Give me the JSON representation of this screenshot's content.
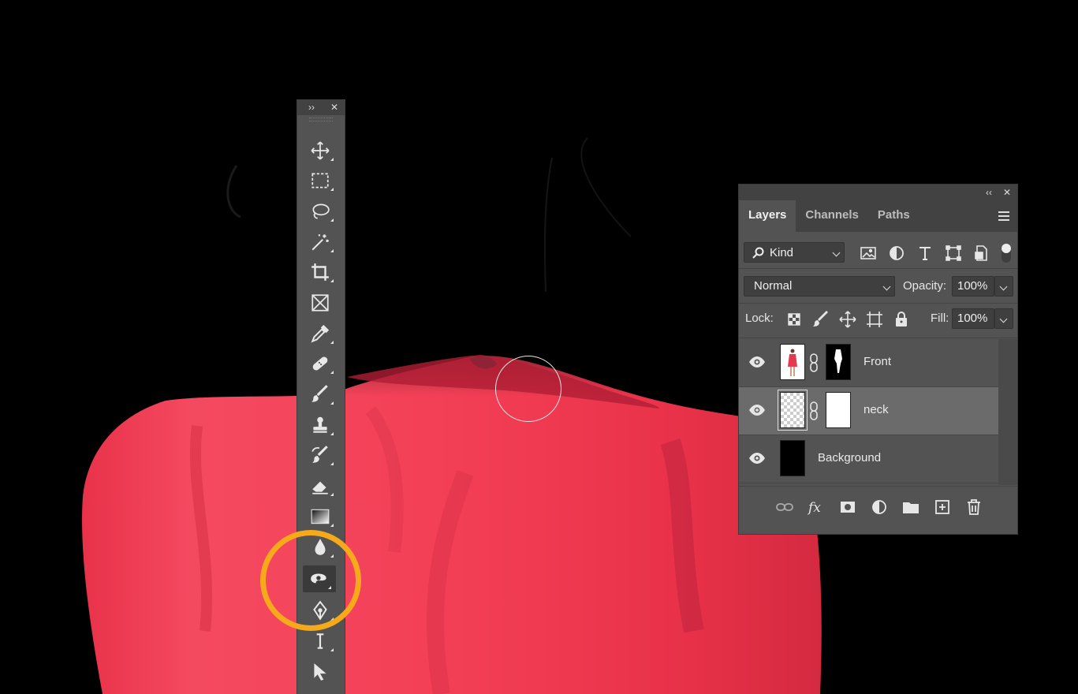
{
  "app": {
    "tools_panel": {
      "expand_glyph": "››",
      "close_glyph": "✕",
      "tools": [
        {
          "name": "move-tool",
          "icon": "move-icon"
        },
        {
          "name": "marquee-tool",
          "icon": "rect-marquee-icon"
        },
        {
          "name": "lasso-tool",
          "icon": "lasso-icon"
        },
        {
          "name": "magic-wand-tool",
          "icon": "magic-wand-icon"
        },
        {
          "name": "crop-tool",
          "icon": "crop-icon"
        },
        {
          "name": "frame-tool",
          "icon": "frame-icon"
        },
        {
          "name": "eyedropper-tool",
          "icon": "eyedropper-icon"
        },
        {
          "name": "healing-brush-tool",
          "icon": "bandage-icon"
        },
        {
          "name": "brush-tool",
          "icon": "brush-icon"
        },
        {
          "name": "clone-stamp-tool",
          "icon": "stamp-icon"
        },
        {
          "name": "history-brush-tool",
          "icon": "history-brush-icon"
        },
        {
          "name": "eraser-tool",
          "icon": "eraser-icon"
        },
        {
          "name": "gradient-tool",
          "icon": "gradient-icon"
        },
        {
          "name": "blur-tool",
          "icon": "blur-drop-icon"
        },
        {
          "name": "dodge-burn-tool",
          "icon": "burn-hand-icon",
          "active": true
        },
        {
          "name": "pen-tool",
          "icon": "pen-icon"
        },
        {
          "name": "type-tool",
          "icon": "type-icon"
        },
        {
          "name": "path-selection-tool",
          "icon": "arrow-icon"
        }
      ]
    },
    "layers_panel": {
      "collapse_glyph": "‹‹",
      "close_glyph": "✕",
      "tabs": [
        {
          "label": "Layers",
          "active": true
        },
        {
          "label": "Channels",
          "active": false
        },
        {
          "label": "Paths",
          "active": false
        }
      ],
      "filter_kind": "Kind",
      "blend_mode": "Normal",
      "opacity_label": "Opacity:",
      "opacity_value": "100%",
      "lock_label": "Lock:",
      "fill_label": "Fill:",
      "fill_value": "100%",
      "layers": [
        {
          "name": "Front",
          "visible": true,
          "selected": false
        },
        {
          "name": "neck",
          "visible": true,
          "selected": true
        },
        {
          "name": "Background",
          "visible": true,
          "selected": false
        }
      ]
    },
    "colors": {
      "dress": "#f03a52",
      "highlight": "#f5a91b",
      "panel": "#535353"
    }
  }
}
